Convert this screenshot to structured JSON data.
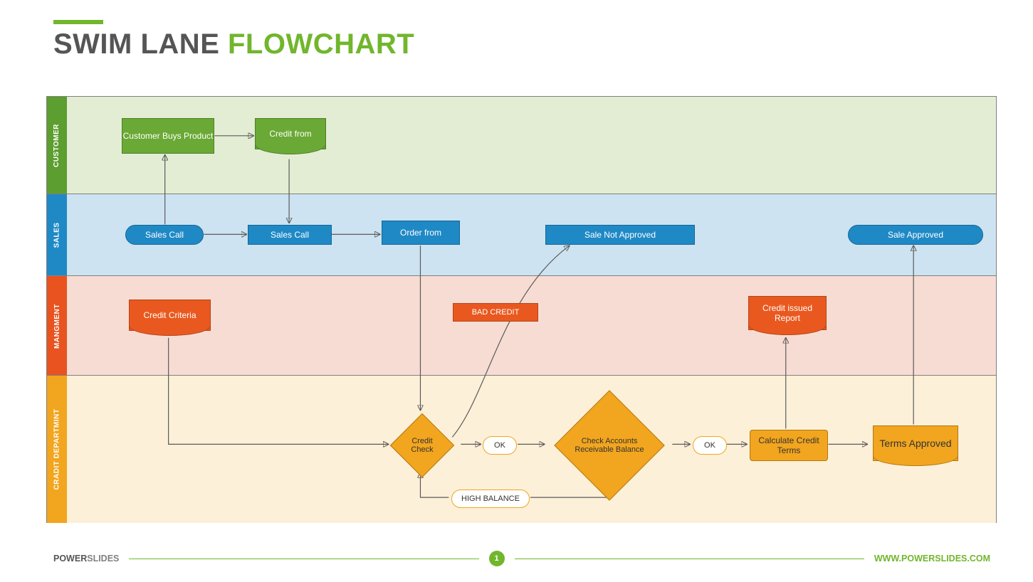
{
  "title": {
    "part1": "SWIM LANE ",
    "part2": "FLOWCHART"
  },
  "lanes": {
    "customer": "CUSTOMER",
    "sales": "SALES",
    "mgmt": "MANGMENT",
    "credit": "CRADIT DEPARTMINT"
  },
  "nodes": {
    "custBuys": "Customer Buys Product",
    "creditFrom": "Credit from",
    "salesCall1": "Sales Call",
    "salesCall2": "Sales Call",
    "orderFrom": "Order from",
    "saleNotApproved": "Sale Not Approved",
    "saleApproved": "Sale Approved",
    "creditCriteria": "Credit Criteria",
    "badCredit": "BAD CREDIT",
    "creditIssued": "Credit issued Report",
    "creditCheck": "Credit Check",
    "ok1": "OK",
    "checkAccounts": "Check Accounts Receivable Balance",
    "ok2": "OK",
    "calcTerms": "Calculate Credit Terms",
    "termsApproved": "Terms Approved",
    "highBalance": "HIGH BALANCE"
  },
  "footer": {
    "brand1": "POWER",
    "brand2": "SLIDES",
    "page": "1",
    "url": "WWW.POWERSLIDES.COM"
  }
}
